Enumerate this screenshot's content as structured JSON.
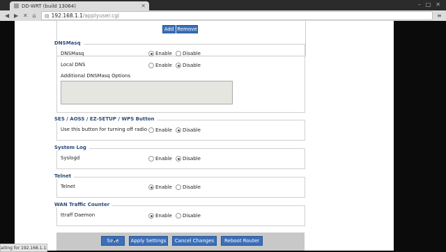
{
  "browser": {
    "tab_title": "DD-WRT (build 13064)",
    "url_host": "192.168.1.1",
    "url_path": "/applyuser.cgi",
    "status": "aiting for 192.168.1.1..."
  },
  "top_buttons": {
    "add": "Add",
    "remove": "Remove"
  },
  "sections": {
    "dnsmasq": {
      "legend": "DNSMasq",
      "row1_label": "DNSMasq",
      "row2_label": "Local DNS",
      "extra_label": "Additional DNSMasq Options"
    },
    "ses": {
      "legend": "SES / AOSS / EZ-SETUP / WPS Button",
      "row_label": "Use this button for turning off radio"
    },
    "syslog": {
      "legend": "System Log",
      "row_label": "Syslogd"
    },
    "telnet": {
      "legend": "Telnet",
      "row_label": "Telnet"
    },
    "wan": {
      "legend": "WAN Traffic Counter",
      "row_label": "ttraff Daemon"
    }
  },
  "options": {
    "enable": "Enable",
    "disable": "Disable"
  },
  "actions": {
    "save": "Save",
    "apply": "Apply Settings",
    "cancel": "Cancel Changes",
    "reboot": "Reboot Router"
  }
}
